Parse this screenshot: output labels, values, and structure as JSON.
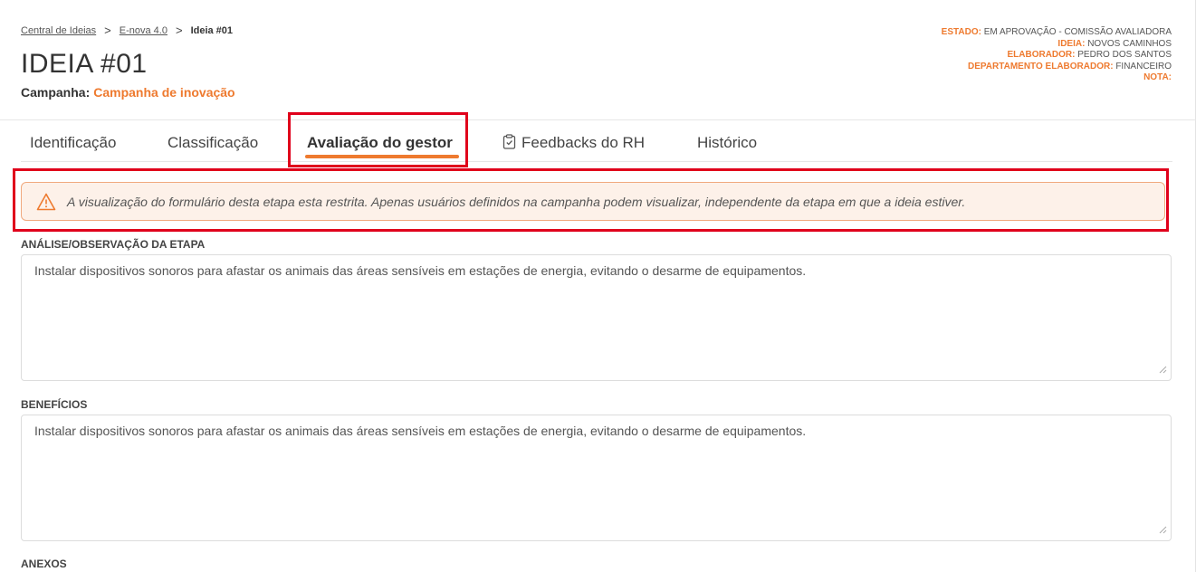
{
  "breadcrumb": {
    "items": [
      {
        "label": "Central de Ideias"
      },
      {
        "label": "E-nova 4.0"
      },
      {
        "label": "Ideia #01"
      }
    ],
    "separator": ">"
  },
  "header": {
    "title": "IDEIA #01",
    "campaign_label": "Campanha:",
    "campaign_value": "Campanha de inovação"
  },
  "meta": {
    "estado_label": "ESTADO:",
    "estado_value": "EM APROVAÇÃO - COMISSÃO AVALIADORA",
    "ideia_label": "IDEIA:",
    "ideia_value": "NOVOS CAMINHOS",
    "elaborador_label": "ELABORADOR:",
    "elaborador_value": "PEDRO DOS SANTOS",
    "departamento_label": "DEPARTAMENTO ELABORADOR:",
    "departamento_value": "FINANCEIRO",
    "nota_label": "NOTA:",
    "nota_value": ""
  },
  "tabs": [
    {
      "label": "Identificação",
      "active": false
    },
    {
      "label": "Classificação",
      "active": false
    },
    {
      "label": "Avaliação do gestor",
      "active": true
    },
    {
      "label": "Feedbacks do RH",
      "active": false,
      "icon": "clipboard-check-icon"
    },
    {
      "label": "Histórico",
      "active": false
    }
  ],
  "alert": {
    "icon": "warning-triangle-icon",
    "text": "A visualização do formulário desta etapa esta restrita. Apenas usuários definidos na campanha podem visualizar, independente da etapa em que a ideia estiver."
  },
  "fields": {
    "analise_label": "ANÁLISE/OBSERVAÇÃO DA ETAPA",
    "analise_value": "Instalar dispositivos sonoros para afastar os animais das áreas sensíveis em estações de energia, evitando o desarme de equipamentos.",
    "beneficios_label": "BENEFÍCIOS",
    "beneficios_value": "Instalar dispositivos sonoros para afastar os animais das áreas sensíveis em estações de energia, evitando o desarme de equipamentos.",
    "anexos_label": "ANEXOS"
  },
  "colors": {
    "accent": "#ee7a2f",
    "highlight_box": "#e0001b",
    "alert_bg": "#fdf1e9",
    "alert_border": "#f0a97e"
  }
}
